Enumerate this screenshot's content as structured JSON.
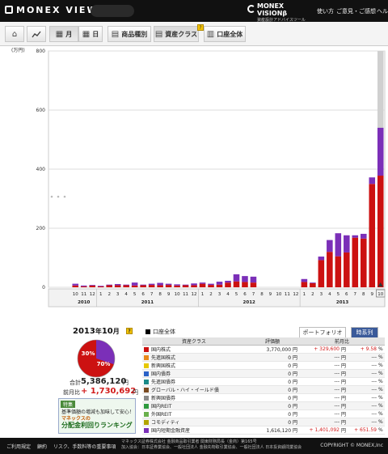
{
  "header": {
    "logo": "MONEX VIEW",
    "logo_beta": "β",
    "vision_line1": "MONEX",
    "vision_line2": "VISIONβ",
    "vision_sub": "資産設計アドバイスツール",
    "nav": [
      "使い方",
      "ご意見・ご感想",
      "ヘル"
    ]
  },
  "toolbar": {
    "home_icon": "home-icon",
    "chart_icon": "line-chart-icon",
    "month_label": "月",
    "day_label": "日",
    "product_label": "商品種別",
    "asset_class_label": "資産クラス",
    "account_all_label": "口座全体",
    "help_mark": "?"
  },
  "chart_data": {
    "type": "bar",
    "stacked": true,
    "ylabel": "(万円)",
    "ylim": [
      0,
      800
    ],
    "yticks": [
      0,
      200,
      400,
      600,
      800
    ],
    "categories": [
      "10",
      "11",
      "12",
      "1",
      "2",
      "3",
      "4",
      "5",
      "6",
      "7",
      "8",
      "9",
      "10",
      "11",
      "12",
      "1",
      "2",
      "3",
      "4",
      "5",
      "6",
      "7",
      "8",
      "9",
      "10",
      "11",
      "12",
      "1",
      "2",
      "3",
      "4",
      "5",
      "6",
      "7",
      "8",
      "9",
      "10"
    ],
    "years": [
      {
        "label": "2010",
        "start": 0,
        "end": 2
      },
      {
        "label": "2011",
        "start": 3,
        "end": 14
      },
      {
        "label": "2012",
        "start": 15,
        "end": 26
      },
      {
        "label": "2013",
        "start": 27,
        "end": 36
      }
    ],
    "series": [
      {
        "name": "国内株式",
        "color": "#cc1111",
        "values": [
          6,
          3,
          6,
          3,
          7,
          7,
          7,
          6,
          7,
          8,
          7,
          8,
          6,
          7,
          7,
          12,
          8,
          9,
          16,
          20,
          18,
          16,
          0,
          0,
          0,
          0,
          0,
          18,
          14,
          92,
          120,
          105,
          118,
          168,
          165,
          350,
          378
        ]
      },
      {
        "name": "国内短期金融資産",
        "color": "#7b2fb8",
        "values": [
          6,
          3,
          2,
          2,
          2,
          4,
          2,
          10,
          2,
          4,
          8,
          4,
          4,
          2,
          6,
          4,
          4,
          10,
          6,
          24,
          20,
          20,
          0,
          0,
          0,
          0,
          0,
          10,
          2,
          12,
          40,
          78,
          58,
          8,
          16,
          22,
          162
        ]
      }
    ],
    "highlight_index": 36,
    "highlight_color": "#d0d0d0"
  },
  "summary": {
    "year": "2013",
    "year_unit": "年",
    "month": "10",
    "month_unit": "月",
    "pie_pct_a": "30%",
    "pie_pct_b": "70%",
    "pie_frac_a": 0.3,
    "total_label": "合計",
    "total_value": "5,386,120",
    "unit_yen": "円",
    "prev_label": "前月比",
    "prev_value": "+ 1,730,692",
    "promo_tag": "特集",
    "promo_line1": "基準価額の増減も加味して安心！",
    "promo_line2": "マネックスの",
    "promo_line3": "分配金利回りランキング"
  },
  "table": {
    "account_label": "口座全体",
    "tabs": [
      "ポートフォリオ",
      "時系列"
    ],
    "headers": [
      "資産クラス",
      "評価額",
      "前月比"
    ],
    "rows": [
      {
        "name": "国内株式",
        "color": "#cc1111",
        "value": "3,770,000",
        "unit": "円",
        "change": "+ 329,600",
        "change_unit": "円",
        "pct": "+ 9.58",
        "pct_unit": "%"
      },
      {
        "name": "先進国株式",
        "color": "#e8891a",
        "value": "0",
        "unit": "円",
        "change": "---",
        "change_unit": "円",
        "pct": "---",
        "pct_unit": "%"
      },
      {
        "name": "新興国株式",
        "color": "#e6c800",
        "value": "0",
        "unit": "円",
        "change": "---",
        "change_unit": "円",
        "pct": "---",
        "pct_unit": "%"
      },
      {
        "name": "国内債券",
        "color": "#2b62c7",
        "value": "0",
        "unit": "円",
        "change": "---",
        "change_unit": "円",
        "pct": "---",
        "pct_unit": "%"
      },
      {
        "name": "先進国債券",
        "color": "#1a8a88",
        "value": "0",
        "unit": "円",
        "change": "---",
        "change_unit": "円",
        "pct": "---",
        "pct_unit": "%"
      },
      {
        "name": "グローバル・ハイ・イールド債",
        "color": "#7a4b22",
        "value": "0",
        "unit": "円",
        "change": "---",
        "change_unit": "円",
        "pct": "---",
        "pct_unit": "%"
      },
      {
        "name": "新興国債券",
        "color": "#8a8a8a",
        "value": "0",
        "unit": "円",
        "change": "---",
        "change_unit": "円",
        "pct": "---",
        "pct_unit": "%"
      },
      {
        "name": "国内REIT",
        "color": "#2f9a3f",
        "value": "0",
        "unit": "円",
        "change": "---",
        "change_unit": "円",
        "pct": "---",
        "pct_unit": "%"
      },
      {
        "name": "外国REIT",
        "color": "#6ab04c",
        "value": "0",
        "unit": "円",
        "change": "---",
        "change_unit": "円",
        "pct": "---",
        "pct_unit": "%"
      },
      {
        "name": "コモディティ",
        "color": "#b2a400",
        "value": "0",
        "unit": "円",
        "change": "---",
        "change_unit": "円",
        "pct": "---",
        "pct_unit": "%"
      },
      {
        "name": "国内短期金融資産",
        "color": "#7b2fb8",
        "value": "1,616,120",
        "unit": "円",
        "change": "+ 1,401,092",
        "change_unit": "円",
        "pct": "+ 651.59",
        "pct_unit": "%"
      }
    ]
  },
  "footer": {
    "links": [
      "ご利用規定",
      "顧約",
      "リスク、手数料等の重要事項"
    ],
    "corp1": "マネックス証券株式会社 金融商品取引業者 関東財務局長（金商）第165号",
    "corp2": "加入協会：日本証券業協会、一般社団法人 金融先物取引業協会、一般社団法人 日本投資顧問業協会",
    "copyright": "COPYRIGHT © MONEX,Inc"
  }
}
